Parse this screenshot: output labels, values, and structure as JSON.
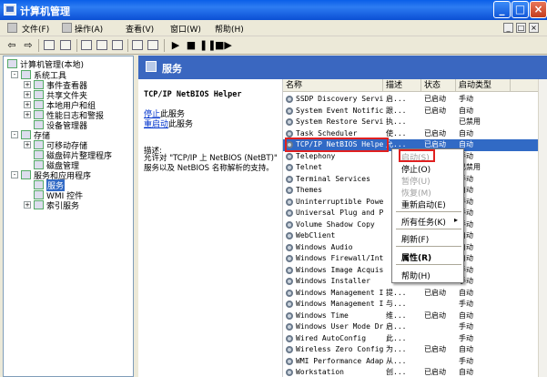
{
  "window": {
    "title": "计算机管理"
  },
  "menubar": {
    "items": [
      "文件(F)",
      "操作(A)",
      "查看(V)",
      "窗口(W)",
      "帮助(H)"
    ],
    "mdi_controls": [
      "_",
      "□",
      "×"
    ]
  },
  "toolbar": {
    "buttons": [
      "back",
      "forward",
      "up",
      "show-tree",
      "properties",
      "refresh",
      "export",
      "help",
      "play",
      "stop",
      "pause",
      "restart"
    ]
  },
  "tree": {
    "root": "计算机管理(本地)",
    "items": [
      {
        "label": "系统工具",
        "level": 1,
        "exp": "-"
      },
      {
        "label": "事件查看器",
        "level": 2,
        "exp": "+"
      },
      {
        "label": "共享文件夹",
        "level": 2,
        "exp": "+"
      },
      {
        "label": "本地用户和组",
        "level": 2,
        "exp": "+"
      },
      {
        "label": "性能日志和警报",
        "level": 2,
        "exp": "+"
      },
      {
        "label": "设备管理器",
        "level": 2,
        "exp": ""
      },
      {
        "label": "存储",
        "level": 1,
        "exp": "-"
      },
      {
        "label": "可移动存储",
        "level": 2,
        "exp": "+"
      },
      {
        "label": "磁盘碎片整理程序",
        "level": 2,
        "exp": ""
      },
      {
        "label": "磁盘管理",
        "level": 2,
        "exp": ""
      },
      {
        "label": "服务和应用程序",
        "level": 1,
        "exp": "-"
      },
      {
        "label": "服务",
        "level": 2,
        "exp": "",
        "selected": true
      },
      {
        "label": "WMI 控件",
        "level": 2,
        "exp": ""
      },
      {
        "label": "索引服务",
        "level": 2,
        "exp": "+"
      }
    ]
  },
  "panel": {
    "title": "服务"
  },
  "detail": {
    "service_name": "TCP/IP NetBIOS Helper",
    "stop_link": "停止",
    "stop_suffix": "此服务",
    "restart_link": "重启动",
    "restart_suffix": "此服务",
    "desc_label": "描述:",
    "desc_text": "允许对 \"TCP/IP 上 NetBIOS (NetBT)\" 服务以及 NetBIOS 名称解析的支持。"
  },
  "columns": [
    "名称",
    "描述",
    "状态",
    "启动类型"
  ],
  "services": [
    {
      "name": "SSDP Discovery Service",
      "desc": "启...",
      "status": "已启动",
      "startup": "手动"
    },
    {
      "name": "System Event Notification",
      "desc": "跟...",
      "status": "已启动",
      "startup": "自动"
    },
    {
      "name": "System Restore Service",
      "desc": "执...",
      "status": "",
      "startup": "已禁用"
    },
    {
      "name": "Task Scheduler",
      "desc": "使...",
      "status": "已启动",
      "startup": "自动"
    },
    {
      "name": "TCP/IP NetBIOS Helper",
      "desc": "允...",
      "status": "已启动",
      "startup": "自动"
    },
    {
      "name": "Telephony",
      "desc": "",
      "status": "",
      "startup": "手动"
    },
    {
      "name": "Telnet",
      "desc": "",
      "status": "",
      "startup": "已禁用"
    },
    {
      "name": "Terminal Services",
      "desc": "",
      "status": "",
      "startup": "手动"
    },
    {
      "name": "Themes",
      "desc": "",
      "status": "",
      "startup": "自动"
    },
    {
      "name": "Uninterruptible Power Su",
      "desc": "",
      "status": "",
      "startup": "手动"
    },
    {
      "name": "Universal Plug and Play",
      "desc": "",
      "status": "",
      "startup": "手动"
    },
    {
      "name": "Volume Shadow Copy",
      "desc": "",
      "status": "",
      "startup": "手动"
    },
    {
      "name": "WebClient",
      "desc": "",
      "status": "",
      "startup": "自动"
    },
    {
      "name": "Windows Audio",
      "desc": "",
      "status": "",
      "startup": "自动"
    },
    {
      "name": "Windows Firewall/Interne",
      "desc": "",
      "status": "",
      "startup": "自动"
    },
    {
      "name": "Windows Image Acquisitio",
      "desc": "",
      "status": "",
      "startup": "手动"
    },
    {
      "name": "Windows Installer",
      "desc": "",
      "status": "",
      "startup": "手动"
    },
    {
      "name": "Windows Management Instr...",
      "desc": "提...",
      "status": "已启动",
      "startup": "自动"
    },
    {
      "name": "Windows Management Instr...",
      "desc": "与...",
      "status": "",
      "startup": "手动"
    },
    {
      "name": "Windows Time",
      "desc": "维...",
      "status": "已启动",
      "startup": "自动"
    },
    {
      "name": "Windows User Mode Driver...",
      "desc": "启...",
      "status": "",
      "startup": "手动"
    },
    {
      "name": "Wired AutoConfig",
      "desc": "此...",
      "status": "",
      "startup": "手动"
    },
    {
      "name": "Wireless Zero Configuration",
      "desc": "为...",
      "status": "已启动",
      "startup": "自动"
    },
    {
      "name": "WMI Performance Adapter",
      "desc": "从...",
      "status": "",
      "startup": "手动"
    },
    {
      "name": "Workstation",
      "desc": "创...",
      "status": "已启动",
      "startup": "自动"
    }
  ],
  "context_menu": {
    "items": [
      {
        "label": "启动(S)",
        "disabled": true
      },
      {
        "label": "停止(O)",
        "disabled": false
      },
      {
        "label": "暂停(U)",
        "disabled": true
      },
      {
        "label": "恢复(M)",
        "disabled": true
      },
      {
        "label": "重新启动(E)",
        "disabled": false
      },
      {
        "label": "所有任务(K)",
        "disabled": false,
        "submenu": true
      },
      {
        "label": "刷新(F)",
        "disabled": false
      },
      {
        "label": "属性(R)",
        "disabled": false,
        "bold": true
      },
      {
        "label": "帮助(H)",
        "disabled": false
      }
    ]
  },
  "colors": {
    "titlebar": "#0A5FE8",
    "selection": "#316AC5",
    "highlight_box": "#E02020",
    "panel_header": "#3A67C0"
  }
}
